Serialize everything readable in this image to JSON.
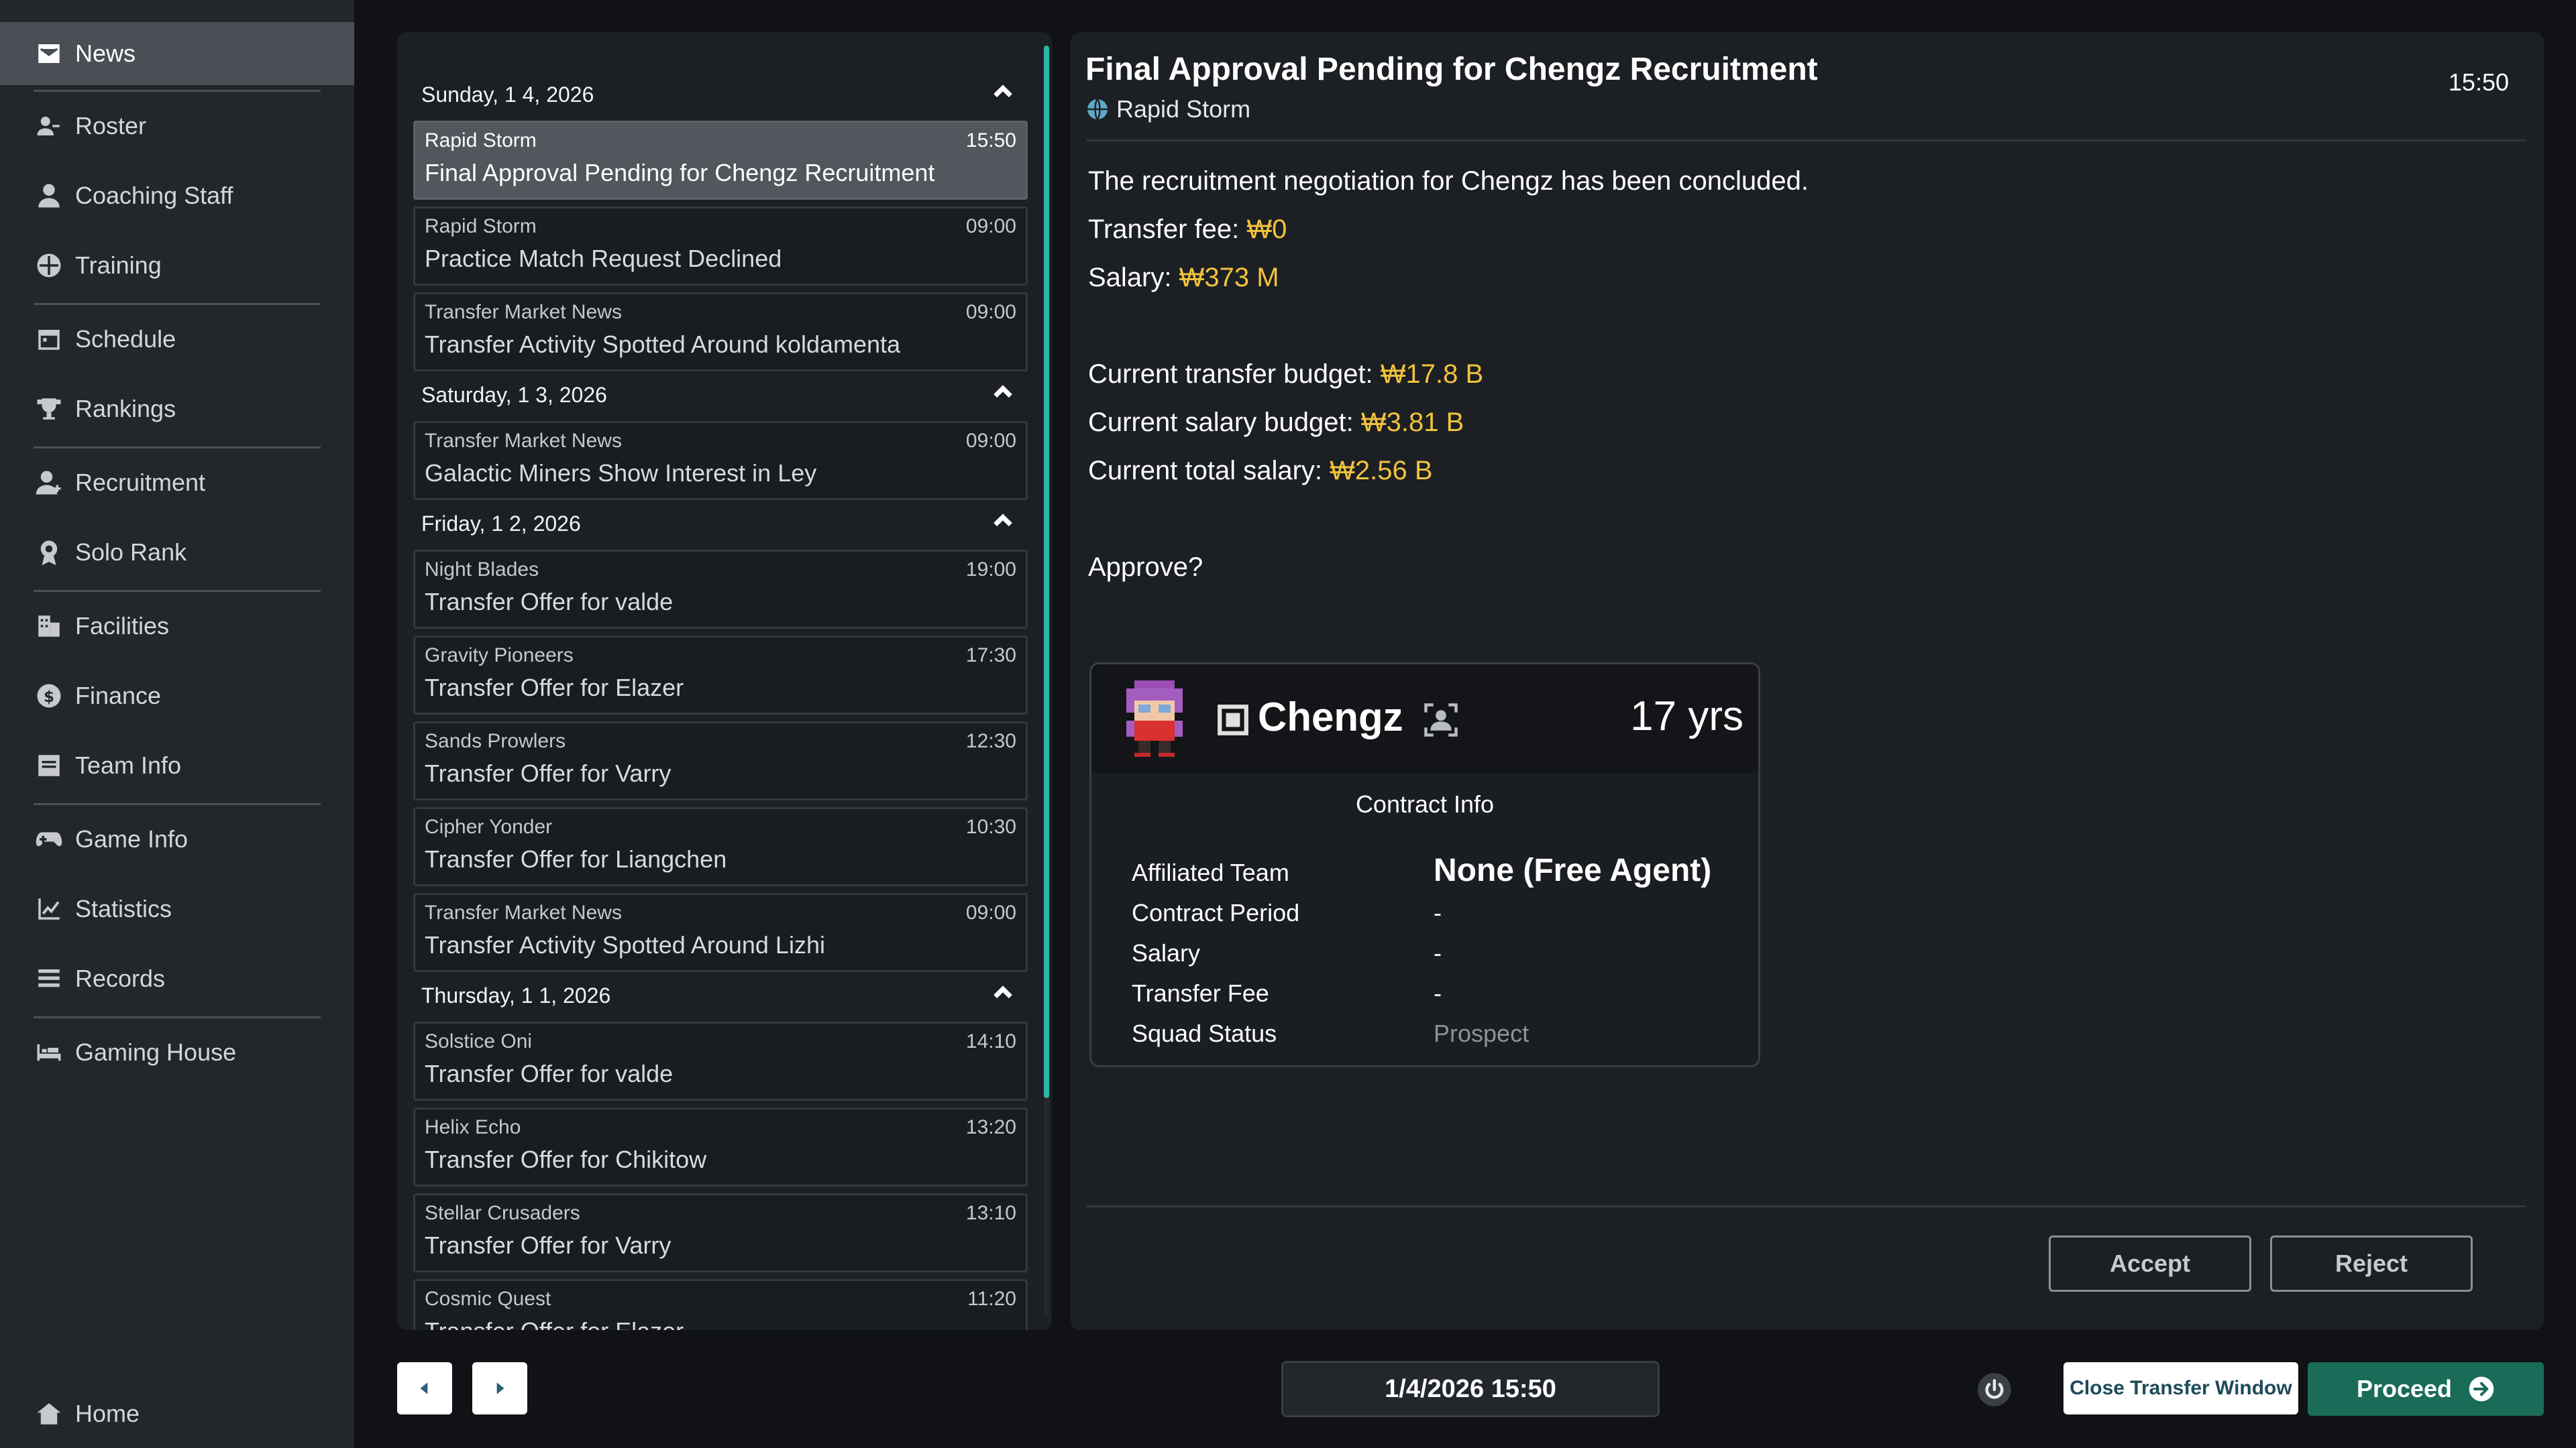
{
  "sidebar": {
    "items": [
      {
        "label": "News",
        "icon": "news-icon"
      },
      {
        "label": "Roster",
        "icon": "roster-icon"
      },
      {
        "label": "Coaching Staff",
        "icon": "coach-icon"
      },
      {
        "label": "Training",
        "icon": "training-icon"
      },
      {
        "label": "Schedule",
        "icon": "calendar-icon"
      },
      {
        "label": "Rankings",
        "icon": "trophy-icon"
      },
      {
        "label": "Recruitment",
        "icon": "add-person-icon"
      },
      {
        "label": "Solo Rank",
        "icon": "medal-icon"
      },
      {
        "label": "Facilities",
        "icon": "building-icon"
      },
      {
        "label": "Finance",
        "icon": "coin-icon"
      },
      {
        "label": "Team Info",
        "icon": "team-card-icon"
      },
      {
        "label": "Game Info",
        "icon": "gamepad-icon"
      },
      {
        "label": "Statistics",
        "icon": "chart-line-icon"
      },
      {
        "label": "Records",
        "icon": "list-icon"
      },
      {
        "label": "Gaming House",
        "icon": "bed-icon"
      }
    ],
    "home": {
      "label": "Home",
      "icon": "home-icon"
    },
    "active": "News"
  },
  "news_list": {
    "groups": [
      {
        "date": "Sunday, 1 4, 2026",
        "items": [
          {
            "source": "Rapid Storm",
            "time": "15:50",
            "title": "Final Approval Pending for Chengz Recruitment",
            "selected": true
          },
          {
            "source": "Rapid Storm",
            "time": "09:00",
            "title": "Practice Match Request Declined"
          },
          {
            "source": "Transfer Market News",
            "time": "09:00",
            "title": "Transfer Activity Spotted Around koldamenta"
          }
        ]
      },
      {
        "date": "Saturday, 1 3, 2026",
        "items": [
          {
            "source": "Transfer Market News",
            "time": "09:00",
            "title": "Galactic Miners Show Interest in Ley"
          }
        ]
      },
      {
        "date": "Friday, 1 2, 2026",
        "items": [
          {
            "source": "Night Blades",
            "time": "19:00",
            "title": "Transfer Offer for valde"
          },
          {
            "source": "Gravity Pioneers",
            "time": "17:30",
            "title": "Transfer Offer for Elazer"
          },
          {
            "source": "Sands Prowlers",
            "time": "12:30",
            "title": "Transfer Offer for Varry"
          },
          {
            "source": "Cipher Yonder",
            "time": "10:30",
            "title": "Transfer Offer for Liangchen"
          },
          {
            "source": "Transfer Market News",
            "time": "09:00",
            "title": "Transfer Activity Spotted Around Lizhi"
          }
        ]
      },
      {
        "date": "Thursday, 1 1, 2026",
        "items": [
          {
            "source": "Solstice Oni",
            "time": "14:10",
            "title": "Transfer Offer for valde"
          },
          {
            "source": "Helix Echo",
            "time": "13:20",
            "title": "Transfer Offer for Chikitow"
          },
          {
            "source": "Stellar Crusaders",
            "time": "13:10",
            "title": "Transfer Offer for Varry"
          },
          {
            "source": "Cosmic Quest",
            "time": "11:20",
            "title": "Transfer Offer for Elazer"
          }
        ]
      }
    ]
  },
  "detail": {
    "title": "Final Approval Pending for Chengz Recruitment",
    "time": "15:50",
    "team": "Rapid Storm",
    "intro": "The recruitment negotiation for Chengz has been concluded.",
    "transfer_fee_label": "Transfer fee: ",
    "transfer_fee_value": "₩0",
    "salary_label": "Salary: ",
    "salary_value": "₩373 M",
    "transfer_budget_label": "Current transfer budget: ",
    "transfer_budget_value": "₩17.8 B",
    "salary_budget_label": "Current salary budget: ",
    "salary_budget_value": "₩3.81 B",
    "total_salary_label": "Current total salary: ",
    "total_salary_value": "₩2.56 B",
    "question": "Approve?",
    "accept_label": "Accept",
    "reject_label": "Reject"
  },
  "player_card": {
    "name": "Chengz",
    "age": "17 yrs",
    "contract_header": "Contract Info",
    "rows": [
      {
        "label": "Affiliated Team",
        "value": "None (Free Agent)"
      },
      {
        "label": "Contract Period",
        "value": "-"
      },
      {
        "label": "Salary",
        "value": "-"
      },
      {
        "label": "Transfer Fee",
        "value": "-"
      },
      {
        "label": "Squad Status",
        "value": "Prospect"
      }
    ]
  },
  "bottom_bar": {
    "datetime": "1/4/2026 15:50",
    "close_transfer_window_label": "Close Transfer Window",
    "proceed_label": "Proceed"
  },
  "colors": {
    "accent_teal": "#2fb5a5",
    "money_yellow": "#f1c33c",
    "proceed_green": "#1a6b57"
  }
}
